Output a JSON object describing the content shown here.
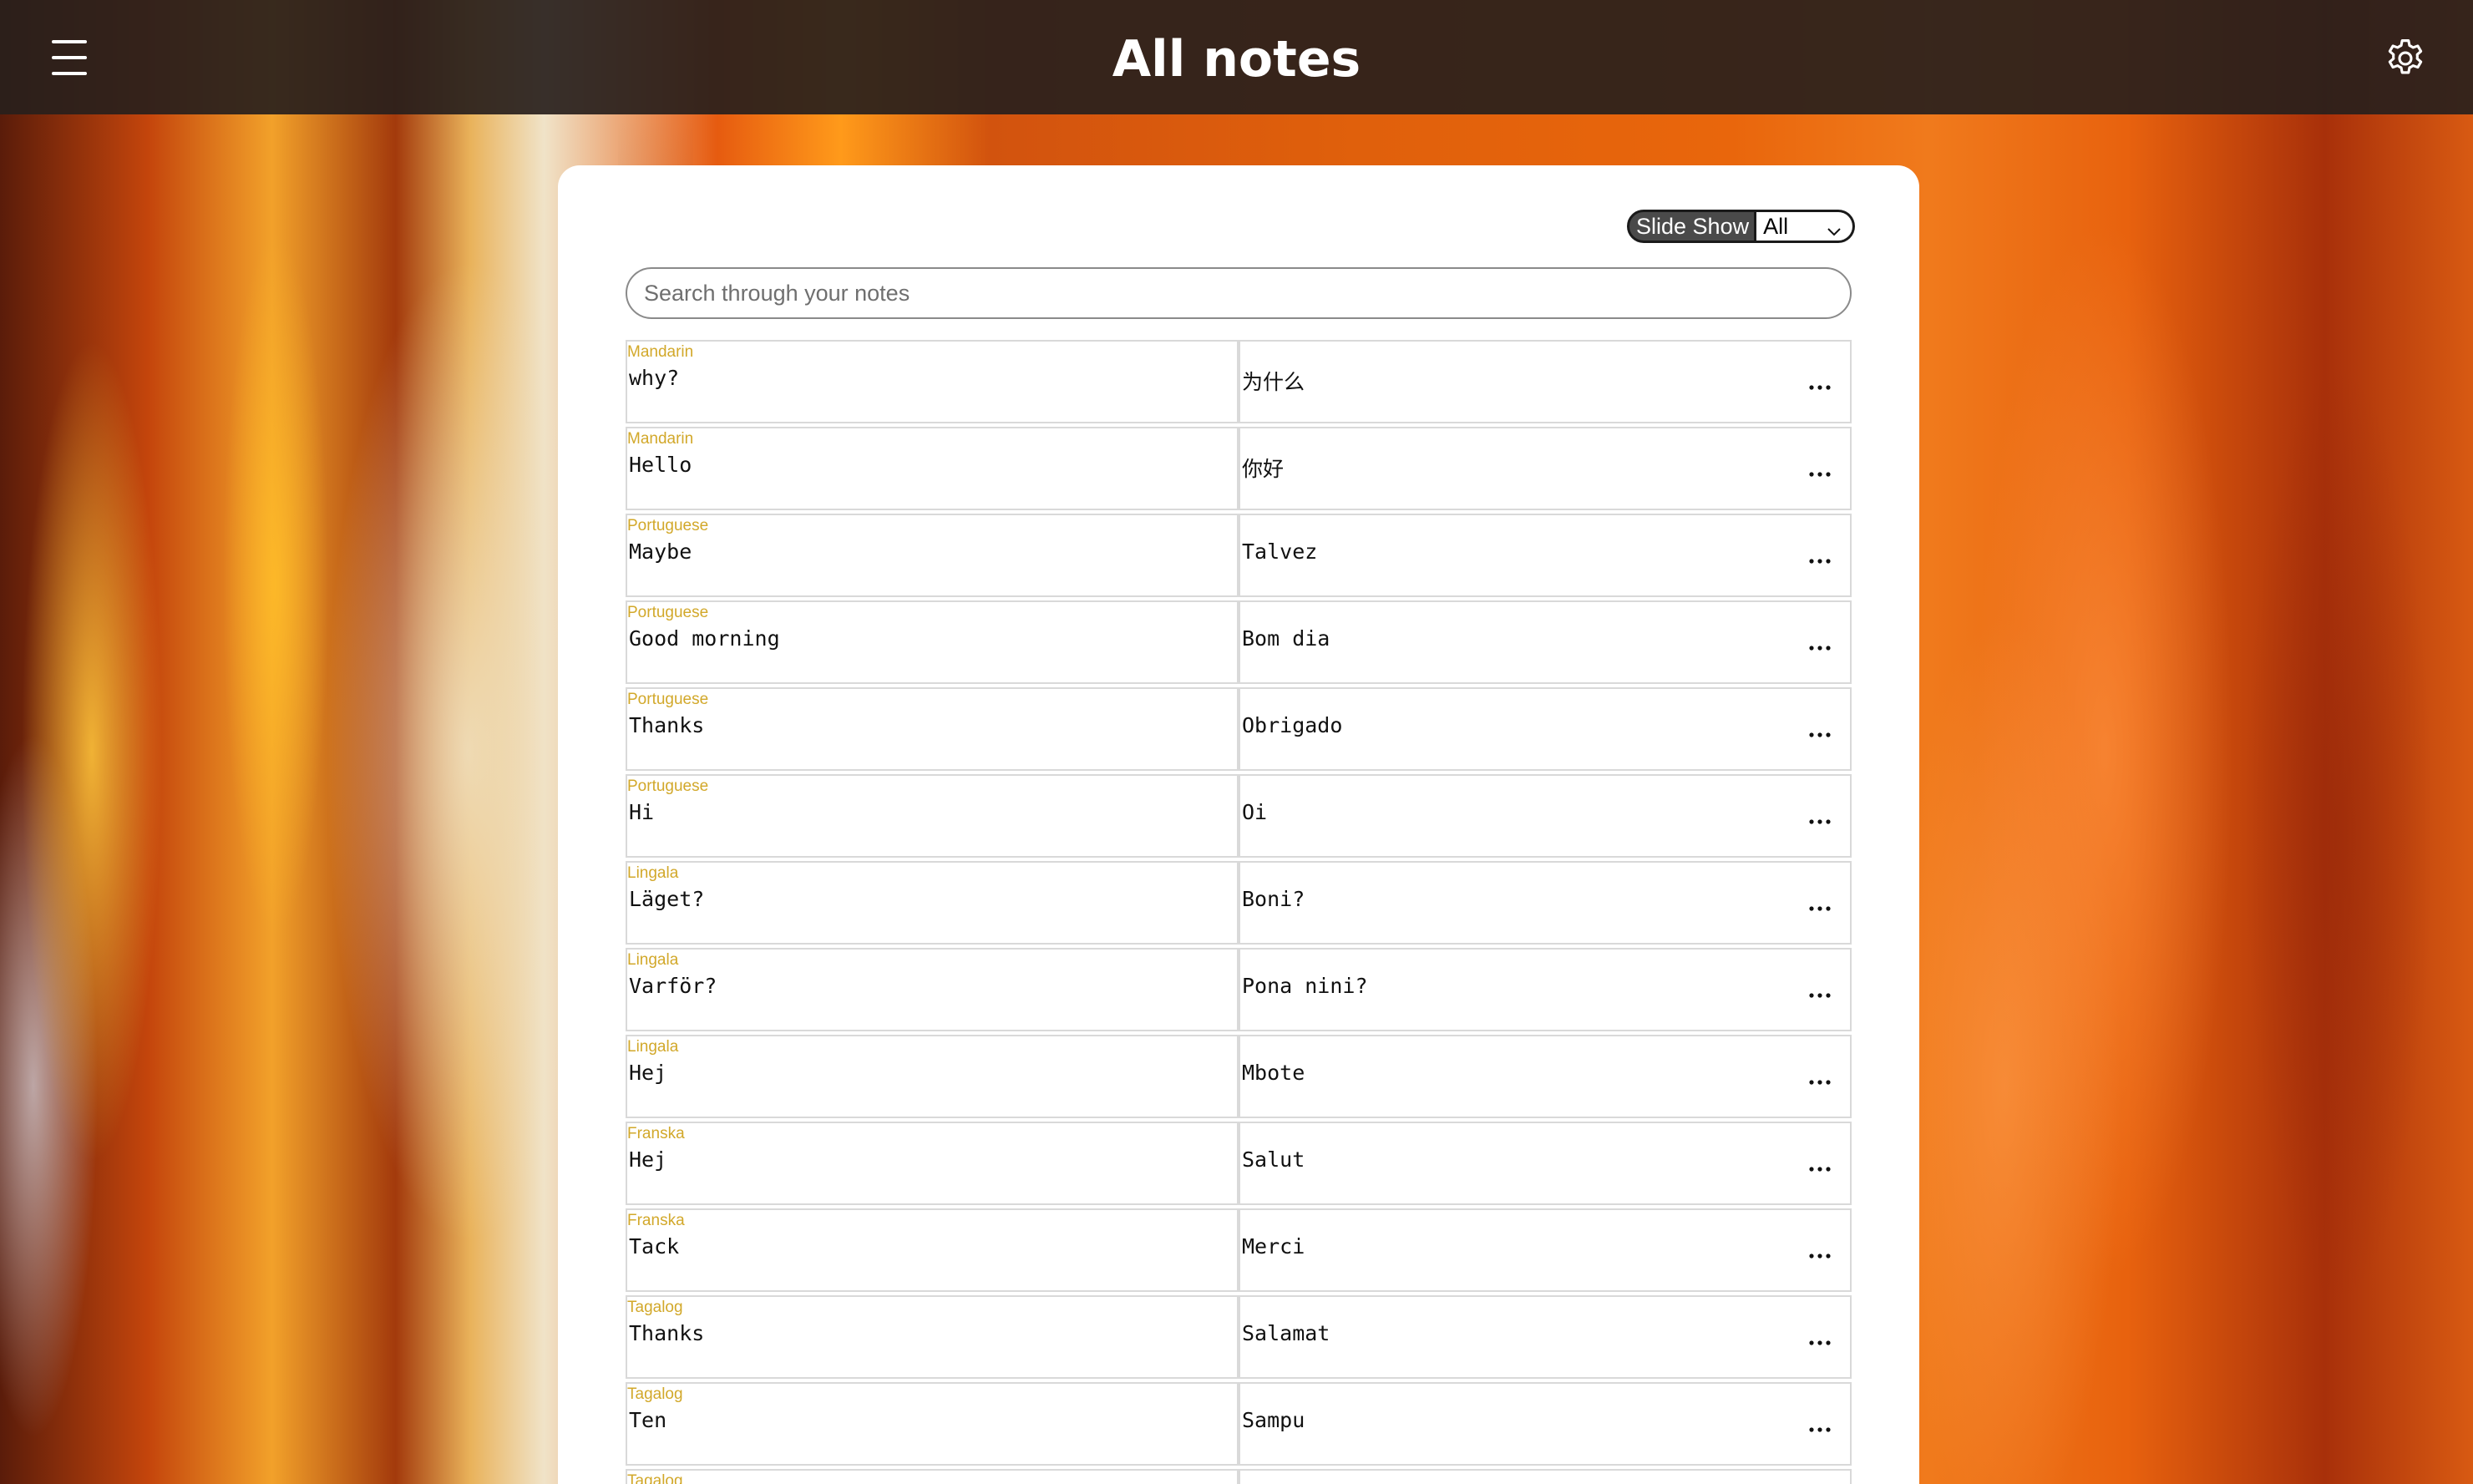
{
  "header": {
    "title": "All notes",
    "menu_icon": "hamburger-menu-icon",
    "settings_icon": "gear-icon"
  },
  "toolbar": {
    "slideshow_label": "Slide Show",
    "filter_selected": "All"
  },
  "search": {
    "placeholder": "Search through your notes",
    "value": ""
  },
  "colors": {
    "topbar": "#28201c",
    "language_label": "#d2a82a",
    "slideshow_button": "#4a4a4a"
  },
  "notes": [
    {
      "language": "Mandarin",
      "front": "why?",
      "back": "为什么"
    },
    {
      "language": "Mandarin",
      "front": "Hello",
      "back": "你好"
    },
    {
      "language": "Portuguese",
      "front": "Maybe",
      "back": "Talvez"
    },
    {
      "language": "Portuguese",
      "front": "Good morning",
      "back": "Bom dia"
    },
    {
      "language": "Portuguese",
      "front": "Thanks",
      "back": "Obrigado"
    },
    {
      "language": "Portuguese",
      "front": "Hi",
      "back": "Oi"
    },
    {
      "language": "Lingala",
      "front": "Läget?",
      "back": "Boni?"
    },
    {
      "language": "Lingala",
      "front": "Varför?",
      "back": "Pona nini?"
    },
    {
      "language": "Lingala",
      "front": "Hej",
      "back": "Mbote"
    },
    {
      "language": "Franska",
      "front": "Hej",
      "back": "Salut"
    },
    {
      "language": "Franska",
      "front": "Tack",
      "back": "Merci"
    },
    {
      "language": "Tagalog",
      "front": "Thanks",
      "back": "Salamat"
    },
    {
      "language": "Tagalog",
      "front": "Ten",
      "back": "Sampu"
    },
    {
      "language": "Tagalog",
      "front": "",
      "back": ""
    }
  ]
}
